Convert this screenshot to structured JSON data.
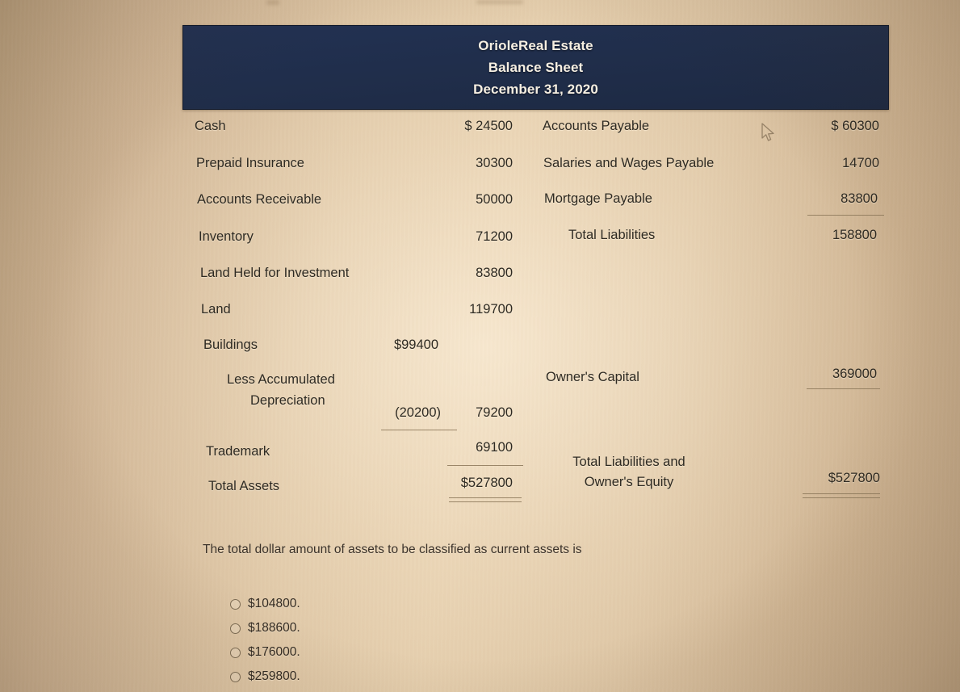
{
  "document": {
    "company": "OrioleReal Estate",
    "statement": "Balance Sheet",
    "date": "December 31, 2020",
    "banner_color": "#202e4b",
    "paper_color": "#e1c9a8"
  },
  "assets": {
    "rows": [
      {
        "label": "Cash",
        "col1": "",
        "col2": "$  24500"
      },
      {
        "label": "Prepaid Insurance",
        "col1": "",
        "col2": "30300"
      },
      {
        "label": "Accounts Receivable",
        "col1": "",
        "col2": "50000"
      },
      {
        "label": "Inventory",
        "col1": "",
        "col2": "71200"
      },
      {
        "label": "Land Held for Investment",
        "col1": "",
        "col2": "83800"
      },
      {
        "label": "Land",
        "col1": "",
        "col2": "119700"
      },
      {
        "label": "Buildings",
        "col1": "$99400",
        "col2": ""
      },
      {
        "label": "Less Accumulated",
        "col1": "",
        "col2": ""
      },
      {
        "label": "Depreciation",
        "col1": "(20200)",
        "col2": "79200"
      },
      {
        "label": "Trademark",
        "col1": "",
        "col2": "69100"
      },
      {
        "label": "Total Assets",
        "col1": "",
        "col2": "$527800"
      }
    ]
  },
  "liabilities": {
    "rows": [
      {
        "label": "Accounts Payable",
        "value": "$  60300"
      },
      {
        "label": "Salaries and Wages Payable",
        "value": "14700"
      },
      {
        "label": "Mortgage Payable",
        "value": "83800"
      },
      {
        "label": "Total Liabilities",
        "value": "158800"
      }
    ]
  },
  "equity": {
    "capital_label": "Owner's Capital",
    "capital_value": "369000",
    "total_label_line1": "Total Liabilities and",
    "total_label_line2": "Owner's Equity",
    "total_value": "$527800"
  },
  "question": {
    "prompt": "The total dollar amount of assets to be classified as current assets is",
    "options": [
      "$104800.",
      "$188600.",
      "$176000.",
      "$259800."
    ]
  },
  "cursor": {
    "icon": "arrow-pointer"
  }
}
